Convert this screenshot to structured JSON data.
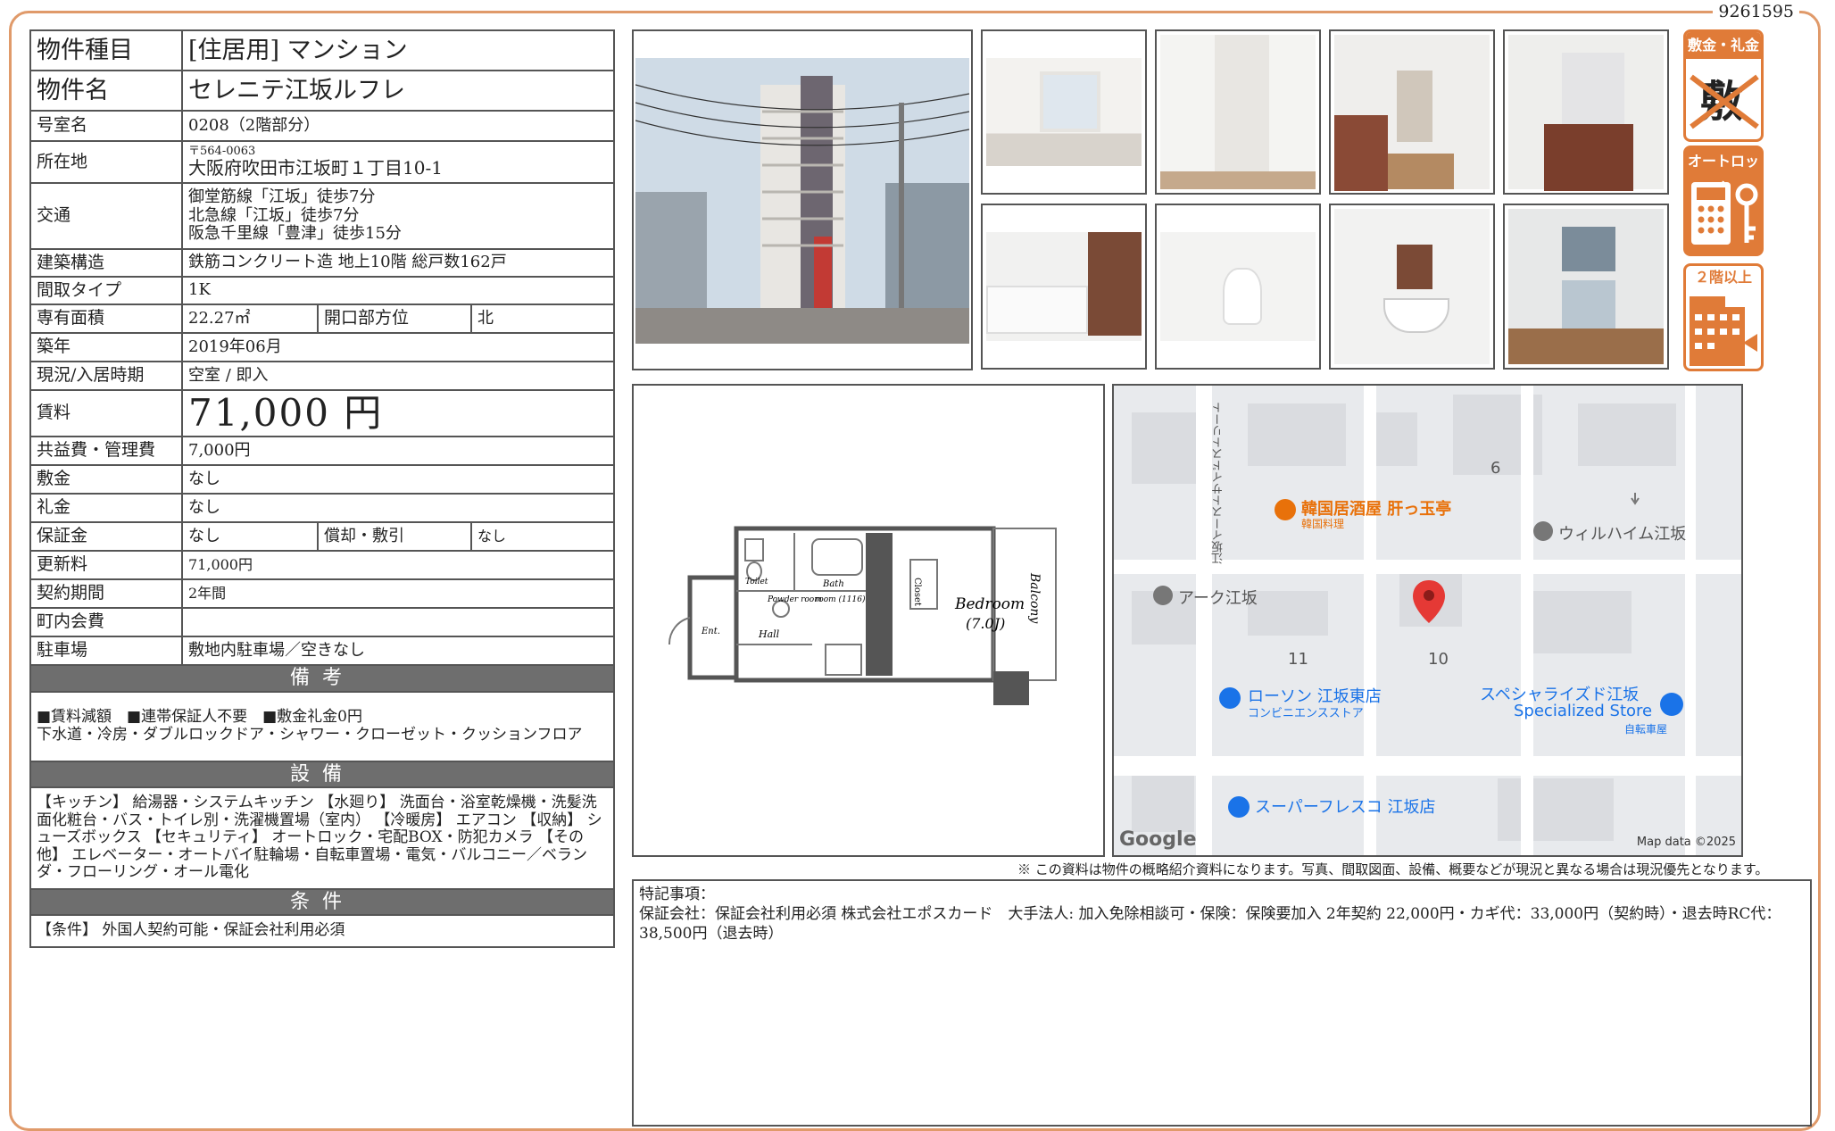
{
  "doc_id": "9261595",
  "spec": {
    "type_label": "物件種目",
    "type_value": "[住居用] マンション",
    "name_label": "物件名",
    "name_value": "セレニテ江坂ルフレ",
    "room_label": "号室名",
    "room_value": "0208（2階部分）",
    "address_label": "所在地",
    "address_zip": "〒564-0063",
    "address_value": "大阪府吹田市江坂町１丁目10-1",
    "traffic_label": "交通",
    "traffic": [
      "御堂筋線「江坂」徒歩7分",
      "北急線「江坂」徒歩7分",
      "阪急千里線「豊津」徒歩15分"
    ],
    "structure_label": "建築構造",
    "structure_value": "鉄筋コンクリート造 地上10階 総戸数162戸",
    "layout_label": "間取タイプ",
    "layout_value": "1K",
    "area_label": "専有面積",
    "area_value": "22.27㎡",
    "direction_label": "開口部方位",
    "direction_value": "北",
    "built_label": "築年",
    "built_value": "2019年06月",
    "status_label": "現況/入居時期",
    "status_value": "空室 / 即入",
    "rent_label": "賃料",
    "rent_value": "71,000 円",
    "fee_label": "共益費・管理費",
    "fee_value": "7,000円",
    "deposit_label": "敷金",
    "deposit_value": "なし",
    "keymoney_label": "礼金",
    "keymoney_value": "なし",
    "guarantee_label": "保証金",
    "guarantee_value": "なし",
    "amort_label": "償却・敷引",
    "amort_value": "なし",
    "renewal_label": "更新料",
    "renewal_value": "71,000円",
    "term_label": "契約期間",
    "term_value": "2年間",
    "assoc_label": "町内会費",
    "assoc_value": "",
    "parking_label": "駐車場",
    "parking_value": "敷地内駐車場／空きなし",
    "notes_header": "備考",
    "notes_line1": "■賃料減額　■連帯保証人不要　■敷金礼金0円",
    "notes_line2": "下水道・冷房・ダブルロックドア・シャワー・クローゼット・クッションフロア",
    "equip_header": "設備",
    "equip_text": "【キッチン】 給湯器・システムキッチン 【水廻り】 洗面台・浴室乾燥機・洗髪洗面化粧台・バス・トイレ別・洗濯機置場（室内） 【冷暖房】 エアコン 【収納】 シューズボックス 【セキュリティ】 オートロック・宅配BOX・防犯カメラ 【その他】 エレベーター・オートバイ駐輪場・自転車置場・電気・バルコニー／ベランダ・フローリング・オール電化",
    "cond_header": "条件",
    "cond_text": "【条件】 外国人契約可能・保証会社利用必須"
  },
  "badges": {
    "zero_title": "敷金・礼金ゼロ",
    "zero_glyphs": "敷礼",
    "autolock_title": "オートロック",
    "floor_title": "２階以上"
  },
  "floorplan": {
    "bedroom": "Bedroom",
    "bedroom_size": "(7.0J)",
    "balcony": "Balcony",
    "closet": "Closet",
    "bath": "Bath",
    "bath_size": "room (1116)",
    "toilet": "Toilet",
    "powder": "Powder room",
    "hall": "Hall",
    "ent": "Ent."
  },
  "map": {
    "street": "江坂イーストサイドストリート",
    "block6": "6",
    "block10": "10",
    "block11": "11",
    "poi_izakaya": "韓国居酒屋 肝っ玉亭",
    "poi_izakaya_sub": "韓国料理",
    "poi_wilheim": "ウィルハイム江坂",
    "poi_ark": "アーク江坂",
    "poi_lawson": "ローソン 江坂東店",
    "poi_lawson_sub": "コンビニエンスストア",
    "poi_specialized": "スペシャライズド江坂",
    "poi_specialized_en": "Specialized Store",
    "poi_specialized_sub": "自転車屋",
    "poi_fresco": "スーパーフレスコ 江坂店",
    "google": "Google",
    "mapdata": "Map data ©2025"
  },
  "disclaimer": "※ この資料は物件の概略紹介資料になります。写真、間取図面、設備、概要などが現況と異なる場合は現況優先となります。",
  "remarks": {
    "title": "特記事項：",
    "body": "保証会社：保証会社利用必須 株式会社エポスカード　大手法人: 加入免除相談可・保険：保険要加入 2年契約 22,000円・カギ代：33,000円（契約時）・退去時RC代：38,500円（退去時）"
  },
  "colors": {
    "accent": "#e07b38",
    "frame": "#e09a6a",
    "section": "#6e6e6e",
    "pin": "#e53935",
    "poi_blue": "#1a73e8",
    "poi_orange": "#e8710a"
  }
}
